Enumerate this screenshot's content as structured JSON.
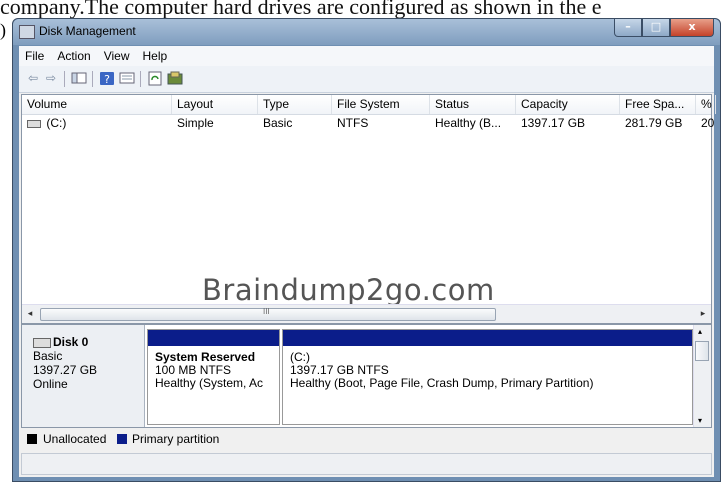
{
  "background_text": "company.The computer hard drives are configured as shown in the e",
  "background_fragment": ")",
  "window": {
    "title": "Disk Management",
    "minimize": "–",
    "maximize": "□",
    "close": "x"
  },
  "menu": [
    "File",
    "Action",
    "View",
    "Help"
  ],
  "toolbar_icons": [
    "back-arrow-icon",
    "forward-arrow-icon",
    "console-tree-icon",
    "help-icon",
    "properties-icon",
    "refresh-icon",
    "rescan-disks-icon"
  ],
  "volume_list": {
    "columns": [
      "Volume",
      "Layout",
      "Type",
      "File System",
      "Status",
      "Capacity",
      "Free Spa...",
      "%"
    ],
    "rows": [
      {
        "volume": "(C:)",
        "layout": "Simple",
        "type": "Basic",
        "file_system": "NTFS",
        "status": "Healthy (B...",
        "capacity": "1397.17 GB",
        "free_space": "281.79 GB",
        "percent": "20"
      }
    ]
  },
  "watermark": "Braindump2go.com",
  "scroll_grip": "III",
  "disk": {
    "name": "Disk 0",
    "type": "Basic",
    "size": "1397.27 GB",
    "status": "Online",
    "partitions": [
      {
        "name": "System Reserved",
        "detail": "100 MB NTFS",
        "status": "Healthy (System, Ac"
      },
      {
        "name": "(C:)",
        "detail": "1397.17 GB NTFS",
        "status": "Healthy (Boot, Page File, Crash Dump, Primary Partition)"
      }
    ]
  },
  "legend": [
    {
      "label": "Unallocated",
      "color": "#000000"
    },
    {
      "label": "Primary partition",
      "color": "#0b1d8a"
    }
  ]
}
